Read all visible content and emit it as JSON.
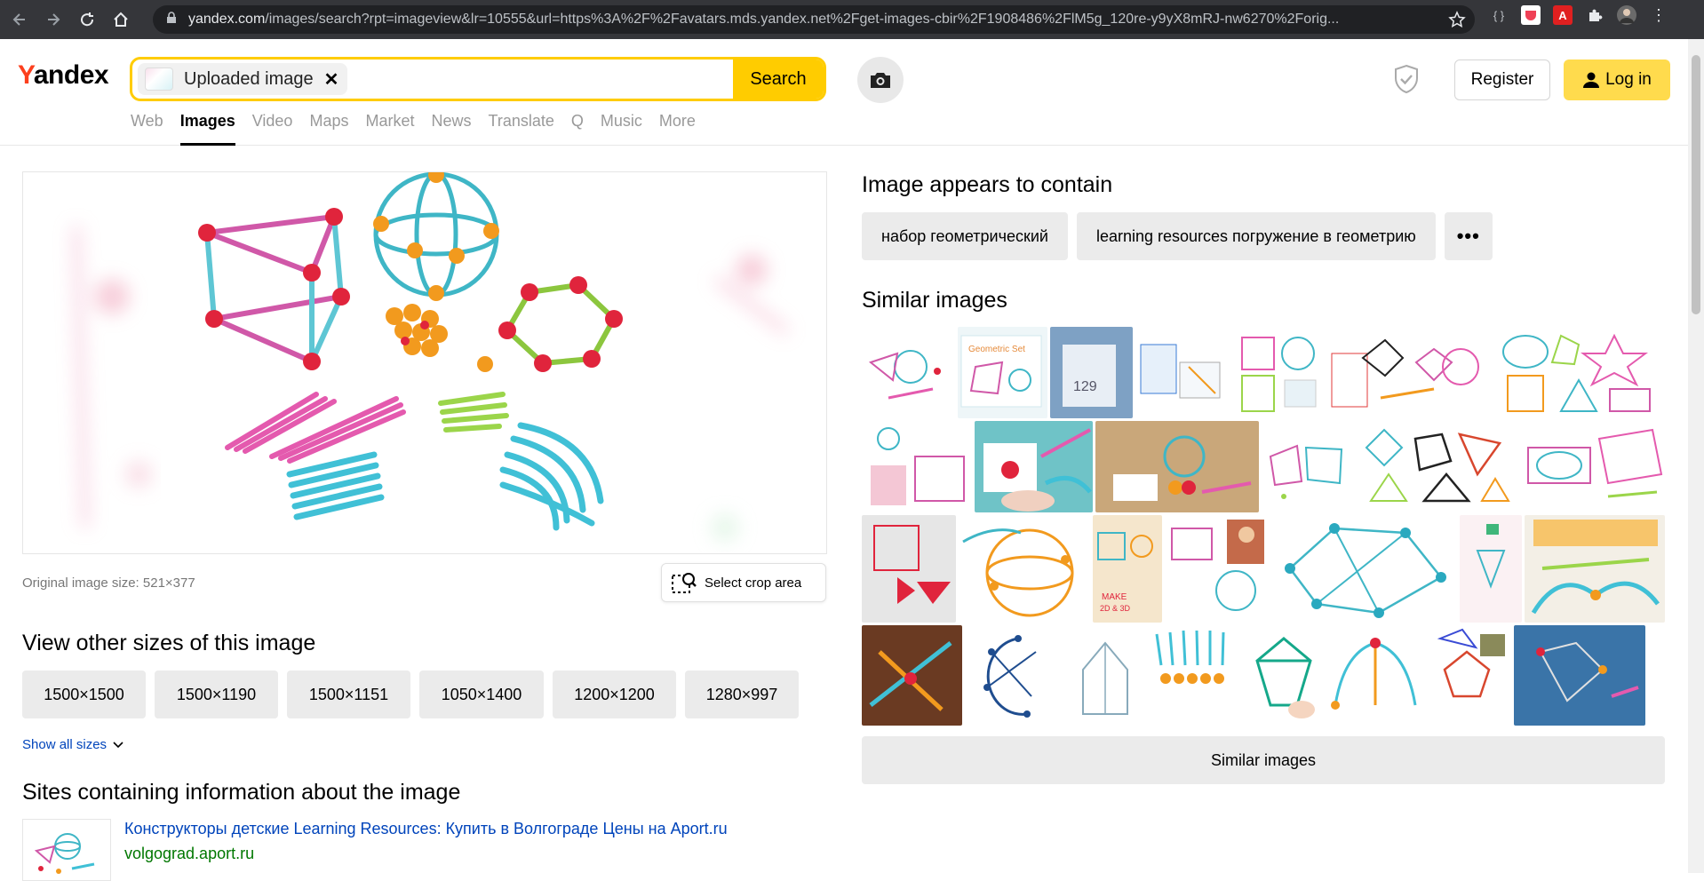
{
  "browser": {
    "url_domain": "yandex.com",
    "url_rest": "/images/search?rpt=imageview&lr=10555&url=https%3A%2F%2Favatars.mds.yandex.net%2Fget-images-cbir%2F1908486%2FlM5g_120re-y9yX8mRJ-nw6270%2Forig..."
  },
  "header": {
    "logo_first": "Y",
    "logo_rest": "andex",
    "search_chip_label": "Uploaded image",
    "search_button": "Search",
    "register": "Register",
    "login": "Log in",
    "tabs": [
      "Web",
      "Images",
      "Video",
      "Maps",
      "Market",
      "News",
      "Translate",
      "Q",
      "Music",
      "More"
    ]
  },
  "left": {
    "original_size": "Original image size: 521×377",
    "crop_label": "Select crop area",
    "other_sizes_title": "View other sizes of this image",
    "sizes": [
      "1500×1500",
      "1500×1190",
      "1500×1151",
      "1050×1400",
      "1200×1200",
      "1280×997"
    ],
    "show_all": "Show all sizes",
    "sites_title": "Sites containing information about the image",
    "site_title": "Конструкторы детские Learning Resources: Купить в Волгограде Цены на Aport.ru",
    "site_domain": "volgograd.aport.ru"
  },
  "right": {
    "contain_title": "Image appears to contain",
    "tags": [
      "набор геометрический",
      "learning resources погружение в геометрию"
    ],
    "more": "•••",
    "similar_title": "Similar images",
    "similar_button": "Similar images"
  },
  "colors": {
    "accent_yellow": "#ffcc00",
    "login_yellow": "#ffdb4d",
    "logo_red": "#fc3f1d",
    "link_blue": "#0044bb"
  }
}
